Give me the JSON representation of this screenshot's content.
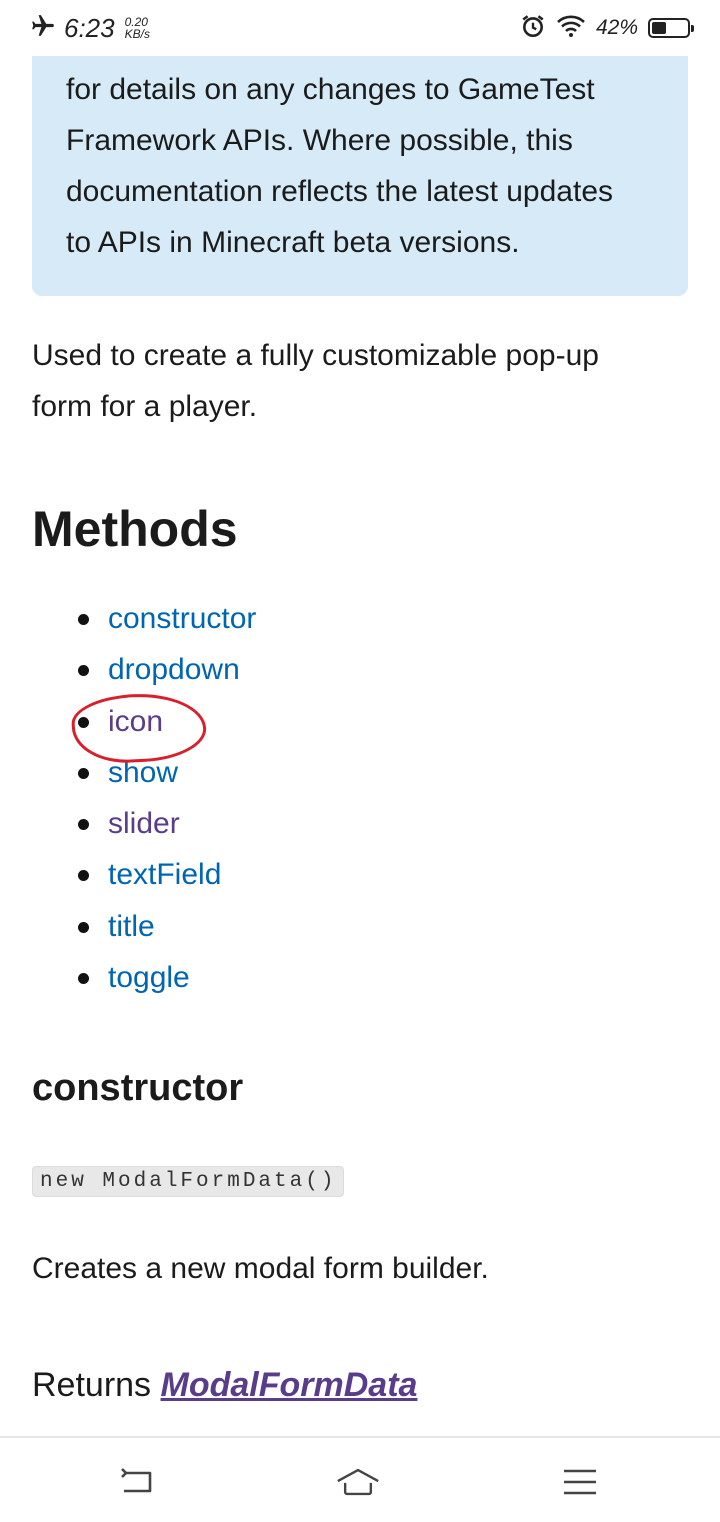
{
  "status_bar": {
    "time": "6:23",
    "speed_value": "0.20",
    "speed_unit": "KB/s",
    "battery": "42%",
    "battery_level": 0.42,
    "icons": [
      "airplane-icon",
      "alarm-icon",
      "wifi-icon",
      "battery-icon"
    ]
  },
  "note": {
    "lines": [
      "for details on any changes to GameTest",
      "Framework APIs. Where possible, this",
      "documentation reflects the latest updates",
      "to APIs in Minecraft beta versions."
    ]
  },
  "intro": {
    "line1": "Used to create a fully customizable pop-up",
    "line2": "form for a player."
  },
  "methods": {
    "heading": "Methods",
    "items": [
      "constructor",
      "dropdown",
      "icon",
      "show",
      "slider",
      "textField",
      "title",
      "toggle"
    ]
  },
  "constructor_section": {
    "heading": "constructor",
    "code": "new ModalFormData()",
    "description": "Creates a new modal form builder.",
    "returns_label": "Returns",
    "returns_type": "ModalFormData"
  },
  "nav": {
    "icons": [
      "back-icon",
      "home-icon",
      "menu-icon"
    ]
  },
  "colors": {
    "link": "#0065b3",
    "visited_link": "#5a3d8a",
    "note_background": "#d6eaf7",
    "annotation": "#d81f2a"
  }
}
